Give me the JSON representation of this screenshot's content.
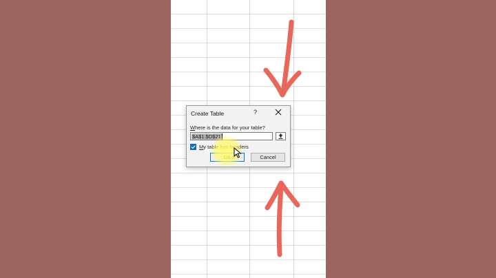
{
  "dialog": {
    "title": "Create Table",
    "help_label": "?",
    "prompt": "Where is the data for your table?",
    "prompt_underline_char": "W",
    "prompt_rest": "here is the data for your table?",
    "range_value": "$A$1:$D$21",
    "collapse_icon": "collapse-arrow-icon",
    "checkbox_label_underline": "M",
    "checkbox_label_rest": "y table has headers",
    "checkbox_checked": true,
    "ok_label": "OK",
    "cancel_label": "Cancel"
  },
  "colors": {
    "background": "#9c6660",
    "arrow": "#e8675a",
    "accent": "#0f6cbd"
  }
}
